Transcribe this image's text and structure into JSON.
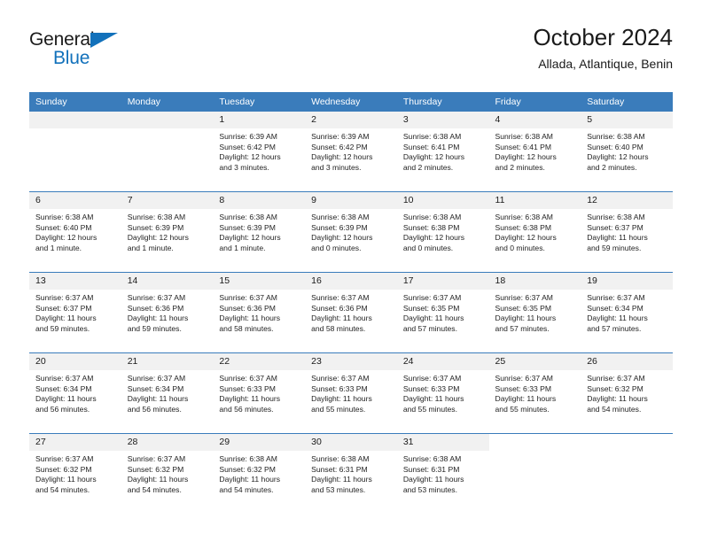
{
  "brand": {
    "name_top": "General",
    "name_bottom": "Blue",
    "triangle_color": "#1271bb"
  },
  "header": {
    "title": "October 2024",
    "subtitle": "Allada, Atlantique, Benin"
  },
  "theme": {
    "header_blue": "#3a7cbb",
    "daynum_gray": "#f1f1f1",
    "text": "#1a1a1a"
  },
  "calendar": {
    "weekday_headers": [
      "Sunday",
      "Monday",
      "Tuesday",
      "Wednesday",
      "Thursday",
      "Friday",
      "Saturday"
    ],
    "weeks": [
      [
        {
          "day": "",
          "lines": []
        },
        {
          "day": "",
          "lines": []
        },
        {
          "day": "1",
          "lines": [
            "Sunrise: 6:39 AM",
            "Sunset: 6:42 PM",
            "Daylight: 12 hours",
            "and 3 minutes."
          ]
        },
        {
          "day": "2",
          "lines": [
            "Sunrise: 6:39 AM",
            "Sunset: 6:42 PM",
            "Daylight: 12 hours",
            "and 3 minutes."
          ]
        },
        {
          "day": "3",
          "lines": [
            "Sunrise: 6:38 AM",
            "Sunset: 6:41 PM",
            "Daylight: 12 hours",
            "and 2 minutes."
          ]
        },
        {
          "day": "4",
          "lines": [
            "Sunrise: 6:38 AM",
            "Sunset: 6:41 PM",
            "Daylight: 12 hours",
            "and 2 minutes."
          ]
        },
        {
          "day": "5",
          "lines": [
            "Sunrise: 6:38 AM",
            "Sunset: 6:40 PM",
            "Daylight: 12 hours",
            "and 2 minutes."
          ]
        }
      ],
      [
        {
          "day": "6",
          "lines": [
            "Sunrise: 6:38 AM",
            "Sunset: 6:40 PM",
            "Daylight: 12 hours",
            "and 1 minute."
          ]
        },
        {
          "day": "7",
          "lines": [
            "Sunrise: 6:38 AM",
            "Sunset: 6:39 PM",
            "Daylight: 12 hours",
            "and 1 minute."
          ]
        },
        {
          "day": "8",
          "lines": [
            "Sunrise: 6:38 AM",
            "Sunset: 6:39 PM",
            "Daylight: 12 hours",
            "and 1 minute."
          ]
        },
        {
          "day": "9",
          "lines": [
            "Sunrise: 6:38 AM",
            "Sunset: 6:39 PM",
            "Daylight: 12 hours",
            "and 0 minutes."
          ]
        },
        {
          "day": "10",
          "lines": [
            "Sunrise: 6:38 AM",
            "Sunset: 6:38 PM",
            "Daylight: 12 hours",
            "and 0 minutes."
          ]
        },
        {
          "day": "11",
          "lines": [
            "Sunrise: 6:38 AM",
            "Sunset: 6:38 PM",
            "Daylight: 12 hours",
            "and 0 minutes."
          ]
        },
        {
          "day": "12",
          "lines": [
            "Sunrise: 6:38 AM",
            "Sunset: 6:37 PM",
            "Daylight: 11 hours",
            "and 59 minutes."
          ]
        }
      ],
      [
        {
          "day": "13",
          "lines": [
            "Sunrise: 6:37 AM",
            "Sunset: 6:37 PM",
            "Daylight: 11 hours",
            "and 59 minutes."
          ]
        },
        {
          "day": "14",
          "lines": [
            "Sunrise: 6:37 AM",
            "Sunset: 6:36 PM",
            "Daylight: 11 hours",
            "and 59 minutes."
          ]
        },
        {
          "day": "15",
          "lines": [
            "Sunrise: 6:37 AM",
            "Sunset: 6:36 PM",
            "Daylight: 11 hours",
            "and 58 minutes."
          ]
        },
        {
          "day": "16",
          "lines": [
            "Sunrise: 6:37 AM",
            "Sunset: 6:36 PM",
            "Daylight: 11 hours",
            "and 58 minutes."
          ]
        },
        {
          "day": "17",
          "lines": [
            "Sunrise: 6:37 AM",
            "Sunset: 6:35 PM",
            "Daylight: 11 hours",
            "and 57 minutes."
          ]
        },
        {
          "day": "18",
          "lines": [
            "Sunrise: 6:37 AM",
            "Sunset: 6:35 PM",
            "Daylight: 11 hours",
            "and 57 minutes."
          ]
        },
        {
          "day": "19",
          "lines": [
            "Sunrise: 6:37 AM",
            "Sunset: 6:34 PM",
            "Daylight: 11 hours",
            "and 57 minutes."
          ]
        }
      ],
      [
        {
          "day": "20",
          "lines": [
            "Sunrise: 6:37 AM",
            "Sunset: 6:34 PM",
            "Daylight: 11 hours",
            "and 56 minutes."
          ]
        },
        {
          "day": "21",
          "lines": [
            "Sunrise: 6:37 AM",
            "Sunset: 6:34 PM",
            "Daylight: 11 hours",
            "and 56 minutes."
          ]
        },
        {
          "day": "22",
          "lines": [
            "Sunrise: 6:37 AM",
            "Sunset: 6:33 PM",
            "Daylight: 11 hours",
            "and 56 minutes."
          ]
        },
        {
          "day": "23",
          "lines": [
            "Sunrise: 6:37 AM",
            "Sunset: 6:33 PM",
            "Daylight: 11 hours",
            "and 55 minutes."
          ]
        },
        {
          "day": "24",
          "lines": [
            "Sunrise: 6:37 AM",
            "Sunset: 6:33 PM",
            "Daylight: 11 hours",
            "and 55 minutes."
          ]
        },
        {
          "day": "25",
          "lines": [
            "Sunrise: 6:37 AM",
            "Sunset: 6:33 PM",
            "Daylight: 11 hours",
            "and 55 minutes."
          ]
        },
        {
          "day": "26",
          "lines": [
            "Sunrise: 6:37 AM",
            "Sunset: 6:32 PM",
            "Daylight: 11 hours",
            "and 54 minutes."
          ]
        }
      ],
      [
        {
          "day": "27",
          "lines": [
            "Sunrise: 6:37 AM",
            "Sunset: 6:32 PM",
            "Daylight: 11 hours",
            "and 54 minutes."
          ]
        },
        {
          "day": "28",
          "lines": [
            "Sunrise: 6:37 AM",
            "Sunset: 6:32 PM",
            "Daylight: 11 hours",
            "and 54 minutes."
          ]
        },
        {
          "day": "29",
          "lines": [
            "Sunrise: 6:38 AM",
            "Sunset: 6:32 PM",
            "Daylight: 11 hours",
            "and 54 minutes."
          ]
        },
        {
          "day": "30",
          "lines": [
            "Sunrise: 6:38 AM",
            "Sunset: 6:31 PM",
            "Daylight: 11 hours",
            "and 53 minutes."
          ]
        },
        {
          "day": "31",
          "lines": [
            "Sunrise: 6:38 AM",
            "Sunset: 6:31 PM",
            "Daylight: 11 hours",
            "and 53 minutes."
          ]
        },
        {
          "day": "",
          "lines": []
        },
        {
          "day": "",
          "lines": []
        }
      ]
    ]
  }
}
